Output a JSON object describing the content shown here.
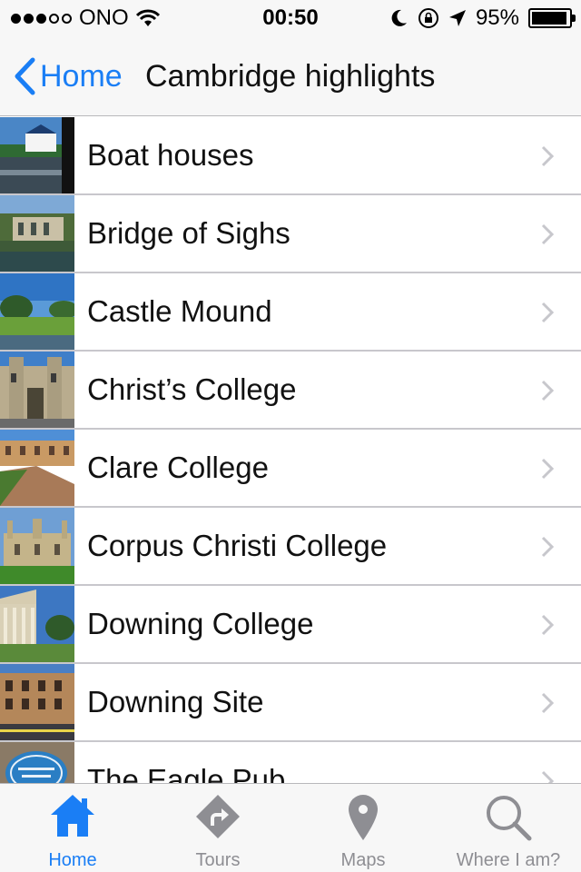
{
  "status_bar": {
    "carrier": "ONO",
    "time": "00:50",
    "battery": "95%"
  },
  "nav": {
    "back_label": "Home",
    "title": "Cambridge highlights"
  },
  "list": {
    "items": [
      {
        "label": "Boat houses"
      },
      {
        "label": "Bridge of Sighs"
      },
      {
        "label": "Castle Mound"
      },
      {
        "label": "Christ’s College"
      },
      {
        "label": "Clare College"
      },
      {
        "label": "Corpus Christi College"
      },
      {
        "label": "Downing College"
      },
      {
        "label": "Downing Site"
      },
      {
        "label": "The Eagle Pub"
      }
    ]
  },
  "tabs": [
    {
      "label": "Home",
      "icon": "home-icon",
      "active": true
    },
    {
      "label": "Tours",
      "icon": "directions-icon",
      "active": false
    },
    {
      "label": "Maps",
      "icon": "map-pin-icon",
      "active": false
    },
    {
      "label": "Where I am?",
      "icon": "search-icon",
      "active": false
    }
  ],
  "colors": {
    "accent": "#1a7ef5",
    "inactive": "#8e8e93"
  }
}
